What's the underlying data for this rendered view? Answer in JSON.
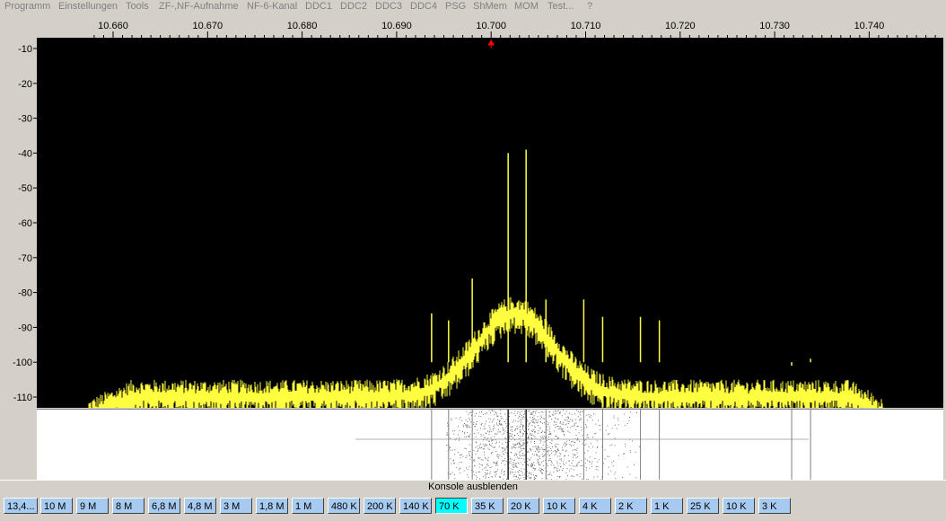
{
  "menu": {
    "items": [
      {
        "label": "Programm"
      },
      {
        "label": "Einstellungen"
      },
      {
        "label": "Tools"
      },
      {
        "label": "ZF-,NF-Aufnahme"
      },
      {
        "label": "NF-6-Kanal"
      },
      {
        "label": "DDC1"
      },
      {
        "label": "DDC2"
      },
      {
        "label": "DDC3"
      },
      {
        "label": "DDC4"
      },
      {
        "label": "PSG"
      },
      {
        "label": "ShMem"
      },
      {
        "label": "MOM"
      },
      {
        "label": "Test..."
      },
      {
        "label": "?"
      }
    ]
  },
  "spectrum": {
    "x_ticks": [
      "10.660",
      "10.670",
      "10.680",
      "10.690",
      "10.700",
      "10.710",
      "10.720",
      "10.730",
      "10.740"
    ],
    "y_ticks": [
      "-10",
      "-20",
      "-30",
      "-40",
      "-50",
      "-60",
      "-70",
      "-80",
      "-90",
      "-100",
      "-110"
    ],
    "center_marker_value": 10.7,
    "trace_color": "#ffff40",
    "background_color": "#000000",
    "noise_floor_db": -109,
    "peaks": [
      {
        "freq": 10.6937,
        "level": -86
      },
      {
        "freq": 10.6955,
        "level": -88
      },
      {
        "freq": 10.698,
        "level": -76
      },
      {
        "freq": 10.7018,
        "level": -40
      },
      {
        "freq": 10.7037,
        "level": -39
      },
      {
        "freq": 10.7058,
        "level": -82
      },
      {
        "freq": 10.7098,
        "level": -82
      },
      {
        "freq": 10.7118,
        "level": -87
      },
      {
        "freq": 10.7158,
        "level": -87
      },
      {
        "freq": 10.7178,
        "level": -88
      },
      {
        "freq": 10.7318,
        "level": -101
      },
      {
        "freq": 10.7338,
        "level": -99
      }
    ]
  },
  "console": {
    "label": "Konsole ausblenden"
  },
  "bandwidth": {
    "buttons": [
      {
        "label": "13,4..."
      },
      {
        "label": "10 M"
      },
      {
        "label": "9 M"
      },
      {
        "label": "8 M"
      },
      {
        "label": "6,8 M"
      },
      {
        "label": "4,8 M"
      },
      {
        "label": "3 M"
      },
      {
        "label": "1,8 M"
      },
      {
        "label": "1 M"
      },
      {
        "label": "480 K"
      },
      {
        "label": "200 K"
      },
      {
        "label": "140 K"
      },
      {
        "label": "70 K"
      },
      {
        "label": "35 K"
      },
      {
        "label": "20 K"
      },
      {
        "label": "10 K"
      },
      {
        "label": "4 K"
      },
      {
        "label": "2 K"
      },
      {
        "label": "1 K"
      },
      {
        "label": "25 K"
      },
      {
        "label": "10 K"
      },
      {
        "label": "3 K"
      }
    ],
    "active_index": 12,
    "active_color": "#00ffff",
    "button_color": "#a6caf0"
  }
}
